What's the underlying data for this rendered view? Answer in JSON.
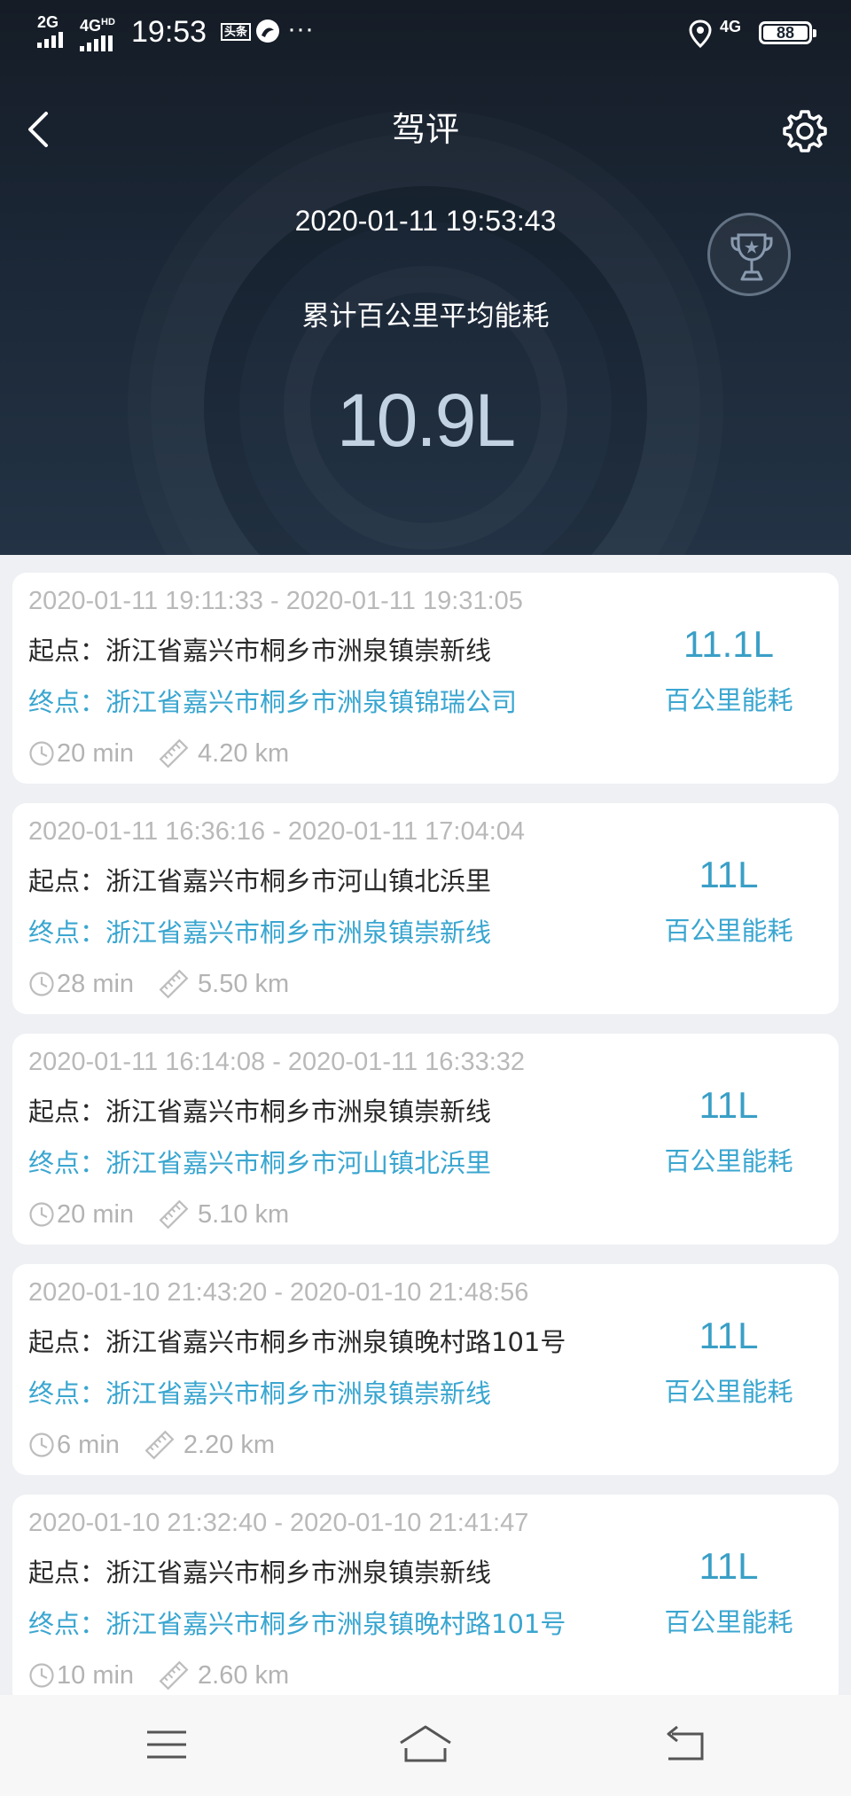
{
  "status_bar": {
    "signal1_label": "2G",
    "signal2_label": "4G",
    "signal2_sup": "HD",
    "time": "19:53",
    "badge": "头条",
    "more": "···",
    "network": "4G",
    "battery": "88"
  },
  "nav": {
    "title": "驾评"
  },
  "summary": {
    "datetime": "2020-01-11 19:53:43",
    "label": "累计百公里平均能耗",
    "value": "10.9L"
  },
  "trips": [
    {
      "time_range": "2020-01-11 19:11:33 - 2020-01-11 19:31:05",
      "start": "起点：浙江省嘉兴市桐乡市洲泉镇崇新线",
      "end": "终点：浙江省嘉兴市桐乡市洲泉镇锦瑞公司",
      "duration": "20 min",
      "distance": "4.20 km",
      "fuel": "11.1L",
      "fuel_label": "百公里能耗"
    },
    {
      "time_range": "2020-01-11 16:36:16 - 2020-01-11 17:04:04",
      "start": "起点：浙江省嘉兴市桐乡市河山镇北浜里",
      "end": "终点：浙江省嘉兴市桐乡市洲泉镇崇新线",
      "duration": "28 min",
      "distance": "5.50 km",
      "fuel": "11L",
      "fuel_label": "百公里能耗"
    },
    {
      "time_range": "2020-01-11 16:14:08 - 2020-01-11 16:33:32",
      "start": "起点：浙江省嘉兴市桐乡市洲泉镇崇新线",
      "end": "终点：浙江省嘉兴市桐乡市河山镇北浜里",
      "duration": "20 min",
      "distance": "5.10 km",
      "fuel": "11L",
      "fuel_label": "百公里能耗"
    },
    {
      "time_range": "2020-01-10 21:43:20 - 2020-01-10 21:48:56",
      "start": "起点：浙江省嘉兴市桐乡市洲泉镇晚村路101号",
      "end": "终点：浙江省嘉兴市桐乡市洲泉镇崇新线",
      "duration": "6 min",
      "distance": "2.20 km",
      "fuel": "11L",
      "fuel_label": "百公里能耗"
    },
    {
      "time_range": "2020-01-10 21:32:40 - 2020-01-10 21:41:47",
      "start": "起点：浙江省嘉兴市桐乡市洲泉镇崇新线",
      "end": "终点：浙江省嘉兴市桐乡市洲泉镇晚村路101号",
      "duration": "10 min",
      "distance": "2.60 km",
      "fuel": "11L",
      "fuel_label": "百公里能耗"
    }
  ],
  "icons": {
    "back": "chevron-left-icon",
    "settings": "gear-icon",
    "trophy": "trophy-icon",
    "clock": "clock-icon",
    "ruler": "ruler-icon",
    "menu": "menu-icon",
    "home": "home-icon",
    "back_nav": "back-arrow-icon"
  },
  "colors": {
    "header_bg": "#1b2736",
    "accent_blue": "#3aa6d0",
    "fuel_value": "#3a9fc6",
    "summary_value": "#c3d2e3",
    "muted_text": "#b9b9b9"
  }
}
